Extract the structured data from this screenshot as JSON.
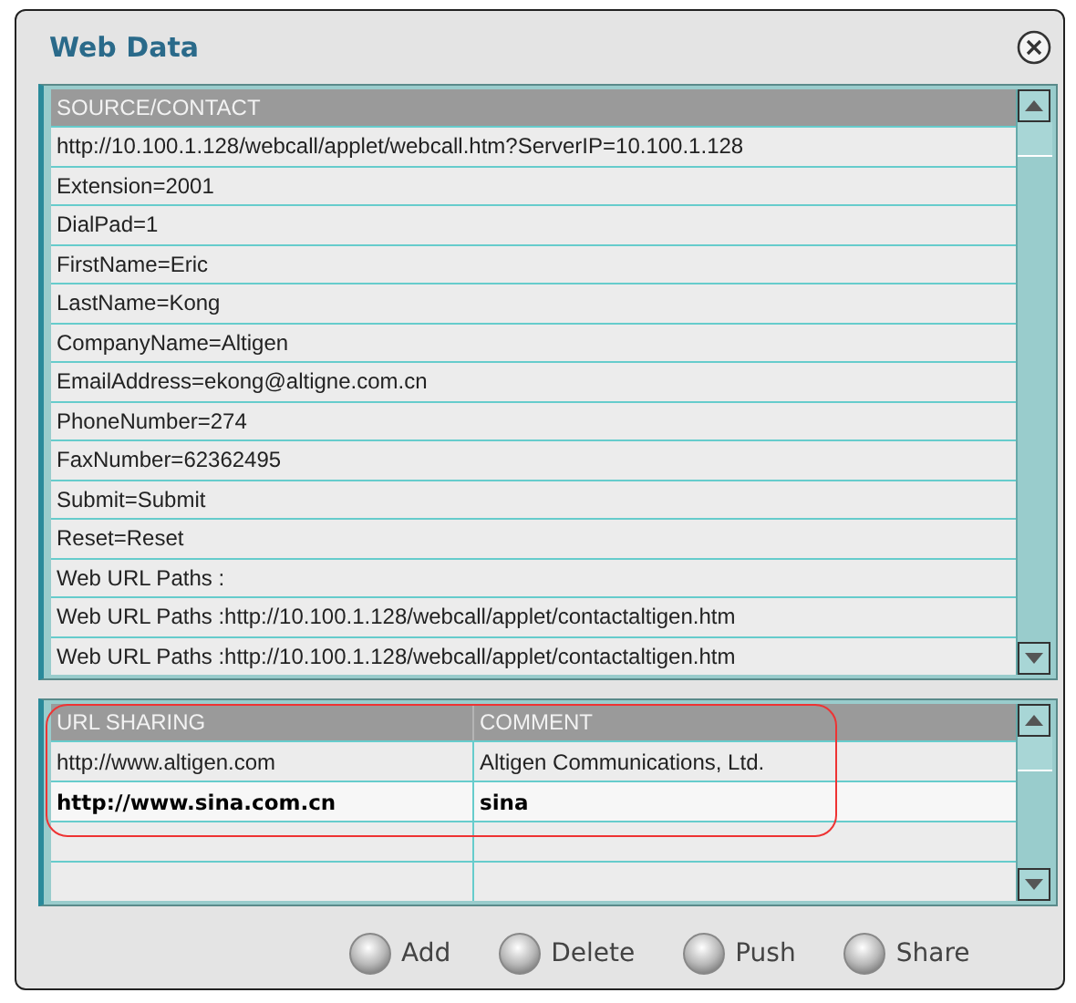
{
  "window": {
    "title": "Web Data"
  },
  "source_list": {
    "header": "SOURCE/CONTACT",
    "rows": [
      "http://10.100.1.128/webcall/applet/webcall.htm?ServerIP=10.100.1.128",
      "Extension=2001",
      "DialPad=1",
      "FirstName=Eric",
      "LastName=Kong",
      "CompanyName=Altigen",
      "EmailAddress=ekong@altigne.com.cn",
      "PhoneNumber=274",
      "FaxNumber=62362495",
      "Submit=Submit",
      "Reset=Reset",
      "Web URL Paths :",
      "Web URL Paths :http://10.100.1.128/webcall/applet/contactaltigen.htm",
      "Web URL Paths :http://10.100.1.128/webcall/applet/contactaltigen.htm"
    ]
  },
  "url_list": {
    "columns": [
      "URL SHARING",
      "COMMENT"
    ],
    "rows": [
      {
        "url": "http://www.altigen.com",
        "comment": "Altigen Communications, Ltd.",
        "selected": false
      },
      {
        "url": "http://www.sina.com.cn",
        "comment": "sina",
        "selected": true
      }
    ]
  },
  "buttons": [
    "Add",
    "Delete",
    "Push",
    "Share"
  ]
}
